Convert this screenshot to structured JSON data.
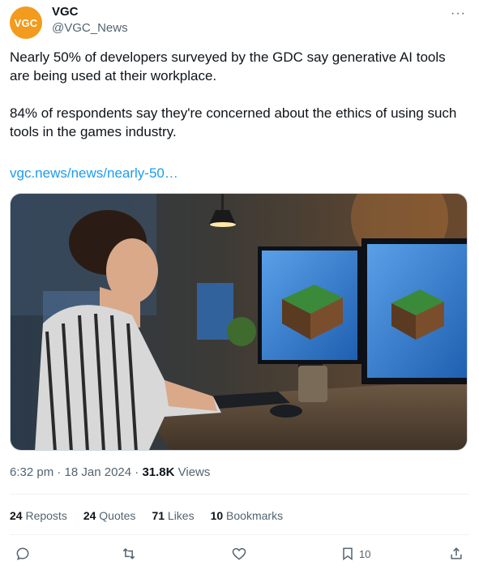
{
  "tweet": {
    "author": {
      "avatar_text": "VGC",
      "display_name": "VGC",
      "handle": "@VGC_News",
      "avatar_color": "#f29b1d"
    },
    "more_label": "···",
    "text_para1": "Nearly 50% of developers surveyed by the GDC say generative AI tools are being used at their workplace.",
    "text_para2": "84% of respondents say they're concerned about the ethics of using such tools in the games industry.",
    "link_text": "vgc.news/news/nearly-50…",
    "link_color": "#1d9bf0",
    "timestamp": "6:32 pm · 18 Jan 2024 · ",
    "views_count": "31.8K",
    "views_label": " Views",
    "stats": [
      {
        "num": "24",
        "label": " Reposts"
      },
      {
        "num": "24",
        "label": " Quotes"
      },
      {
        "num": "71",
        "label": " Likes"
      },
      {
        "num": "10",
        "label": " Bookmarks"
      }
    ],
    "actions": {
      "reply_icon": "reply-icon",
      "retweet_icon": "retweet-icon",
      "like_icon": "heart-icon",
      "bookmark_icon": "bookmark-icon",
      "bookmark_count": "10",
      "share_icon": "share-icon"
    }
  }
}
